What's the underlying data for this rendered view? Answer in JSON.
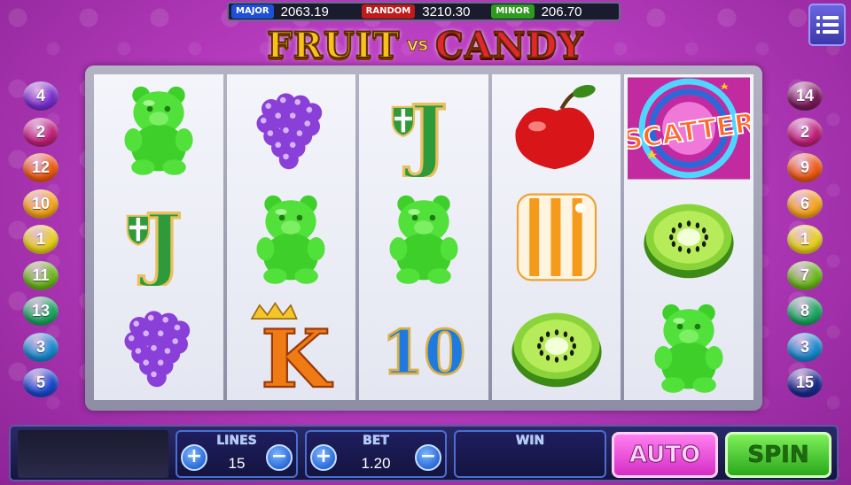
{
  "jackpots": [
    {
      "label": "MAJOR",
      "value": "2063.19",
      "color": "#1e4fd8"
    },
    {
      "label": "RANDOM",
      "value": "3210.30",
      "color": "#c01a1a"
    },
    {
      "label": "MINOR",
      "value": "206.70",
      "color": "#2e9a1e"
    }
  ],
  "title": {
    "word1": "FRUIT",
    "vs": "VS",
    "word2": "CANDY"
  },
  "menu_icon": "menu-list-icon",
  "reels": [
    [
      "gummy-bear",
      "jack",
      "grapes"
    ],
    [
      "grapes",
      "gummy-bear",
      "king"
    ],
    [
      "jack",
      "gummy-bear",
      "ten"
    ],
    [
      "cherry",
      "striped-candy",
      "kiwi"
    ],
    [
      "scatter",
      "kiwi",
      "gummy-bear"
    ]
  ],
  "symbol_text": {
    "jack": "J",
    "king": "K",
    "ten": "10",
    "scatter": "SCATTER"
  },
  "paylines_left": [
    {
      "n": "4",
      "color": "#7a2ed0"
    },
    {
      "n": "2",
      "color": "#c0207a"
    },
    {
      "n": "12",
      "color": "#f05a10"
    },
    {
      "n": "10",
      "color": "#f7a51a"
    },
    {
      "n": "1",
      "color": "#e8d01a"
    },
    {
      "n": "11",
      "color": "#6ab81a"
    },
    {
      "n": "13",
      "color": "#1aa860"
    },
    {
      "n": "3",
      "color": "#1a8ad0"
    },
    {
      "n": "5",
      "color": "#1a4ad0"
    }
  ],
  "paylines_right": [
    {
      "n": "14",
      "color": "#7a1a5a"
    },
    {
      "n": "2",
      "color": "#c0207a"
    },
    {
      "n": "9",
      "color": "#f05a10"
    },
    {
      "n": "6",
      "color": "#f7a51a"
    },
    {
      "n": "1",
      "color": "#e8d01a"
    },
    {
      "n": "7",
      "color": "#6ab81a"
    },
    {
      "n": "8",
      "color": "#1aa860"
    },
    {
      "n": "3",
      "color": "#1a8ad0"
    },
    {
      "n": "15",
      "color": "#1a2a90"
    }
  ],
  "controls": {
    "lines_label": "LINES",
    "lines_value": "15",
    "bet_label": "BET",
    "bet_value": "1.20",
    "win_label": "WIN",
    "win_value": "",
    "plus": "+",
    "minus": "−",
    "auto_label": "AUTO",
    "spin_label": "SPIN"
  }
}
